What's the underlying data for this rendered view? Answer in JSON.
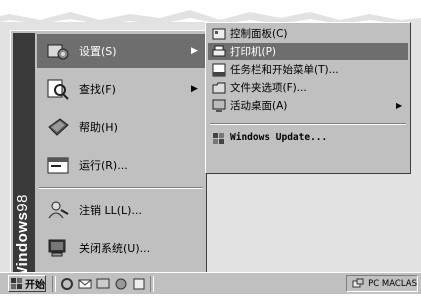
{
  "banner": {
    "brand": "Windows",
    "version": "98"
  },
  "start_menu": {
    "items": [
      {
        "label": "设置(S)",
        "icon": "settings-icon",
        "has_submenu": true,
        "active": true
      },
      {
        "label": "查找(F)",
        "icon": "find-icon",
        "has_submenu": true
      },
      {
        "label": "帮助(H)",
        "icon": "help-icon",
        "has_submenu": false
      },
      {
        "label": "运行(R)...",
        "icon": "run-icon",
        "has_submenu": false
      },
      {
        "label": "注销 LL(L)...",
        "icon": "logoff-icon",
        "has_submenu": false
      },
      {
        "label": "关闭系统(U)...",
        "icon": "shutdown-icon",
        "has_submenu": false
      }
    ]
  },
  "submenu": {
    "items": [
      {
        "label": "控制面板(C)",
        "icon": "control-panel-icon"
      },
      {
        "label": "打印机(P)",
        "icon": "printer-icon",
        "active": true
      },
      {
        "label": "任务栏和开始菜单(T)...",
        "icon": "taskbar-icon"
      },
      {
        "label": "文件夹选项(F)...",
        "icon": "folder-options-icon"
      },
      {
        "label": "活动桌面(A)",
        "icon": "active-desktop-icon",
        "has_submenu": true
      },
      {
        "label": "Windows Update...",
        "icon": "windows-update-icon"
      }
    ]
  },
  "taskbar": {
    "start_label": "开始",
    "tray_text": "PC MACLAS"
  },
  "colors": {
    "menu_bg": "#c0c0c0",
    "highlight": "#6e6e6e",
    "banner": "#3a3a3a"
  }
}
